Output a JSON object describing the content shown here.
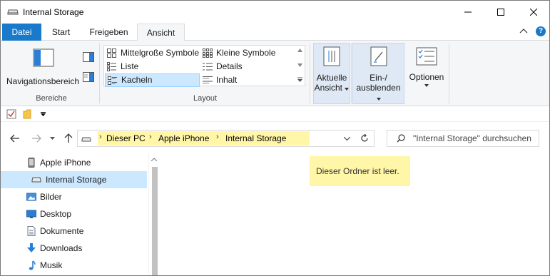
{
  "window": {
    "title": "Internal Storage"
  },
  "ribbon": {
    "tabs": [
      {
        "label": "Datei",
        "active": false
      },
      {
        "label": "Start",
        "active": false
      },
      {
        "label": "Freigeben",
        "active": false
      },
      {
        "label": "Ansicht",
        "active": true
      }
    ],
    "help_label": "?",
    "bereiche": {
      "navpane_label": "Navigationsbereich",
      "group_label": "Bereiche"
    },
    "layout": {
      "group_label": "Layout",
      "items": [
        {
          "label": "Mittelgroße Symbole",
          "selected": false
        },
        {
          "label": "Kleine Symbole",
          "selected": false
        },
        {
          "label": "Liste",
          "selected": false
        },
        {
          "label": "Details",
          "selected": false
        },
        {
          "label": "Kacheln",
          "selected": true
        },
        {
          "label": "Inhalt",
          "selected": false
        }
      ]
    },
    "aktuelle_ansicht": {
      "line1": "Aktuelle",
      "line2": "Ansicht"
    },
    "ein_ausblenden": {
      "line1": "Ein-/",
      "line2": "ausblenden"
    },
    "optionen": {
      "label": "Optionen"
    }
  },
  "address": {
    "crumbs": [
      "Dieser PC",
      "Apple iPhone",
      "Internal Storage"
    ]
  },
  "search": {
    "placeholder": "\"Internal Storage\" durchsuchen"
  },
  "navpane": {
    "items": [
      {
        "label": "Apple iPhone",
        "icon": "phone-icon",
        "selected": false
      },
      {
        "label": "Internal Storage",
        "icon": "drive-icon",
        "selected": true
      },
      {
        "label": "Bilder",
        "icon": "pictures-icon",
        "selected": false
      },
      {
        "label": "Desktop",
        "icon": "desktop-icon",
        "selected": false
      },
      {
        "label": "Dokumente",
        "icon": "documents-icon",
        "selected": false
      },
      {
        "label": "Downloads",
        "icon": "downloads-icon",
        "selected": false
      },
      {
        "label": "Musik",
        "icon": "music-icon",
        "selected": false
      }
    ]
  },
  "content": {
    "empty_message": "Dieser Ordner ist leer."
  },
  "colors": {
    "accent": "#1979ca",
    "selection": "#cce8ff",
    "highlight": "#fff6a8"
  }
}
